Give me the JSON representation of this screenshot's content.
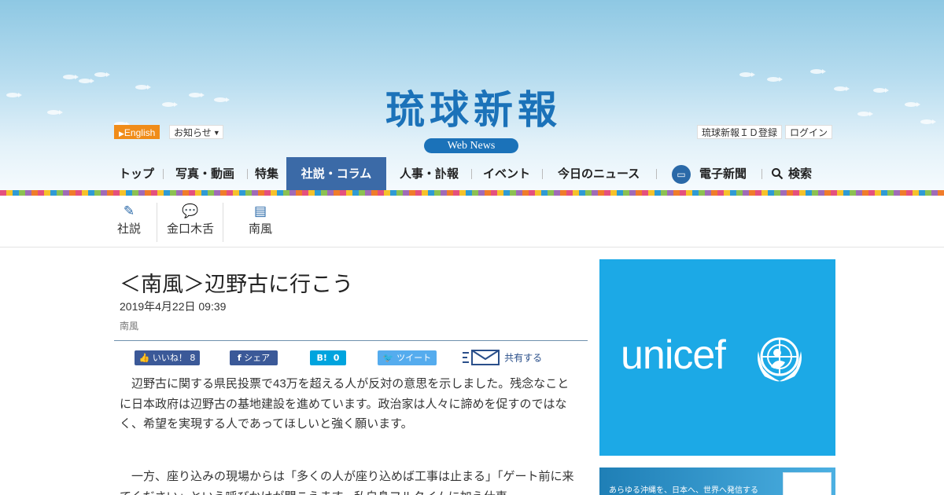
{
  "header": {
    "logo_text": "琉球新報",
    "logo_badge": "Web News",
    "english": "English",
    "notice": "お知らせ",
    "register": "琉球新報ＩＤ登録",
    "login": "ログイン"
  },
  "nav": {
    "items": [
      "トップ",
      "写真・動画",
      "特集",
      "社説・コラム",
      "人事・訃報",
      "イベント",
      "今日のニュース",
      "電子新聞",
      "検索"
    ],
    "active_index": 3
  },
  "subnav": {
    "items": [
      "社説",
      "金口木舌",
      "南風"
    ]
  },
  "article": {
    "title": "＜南風＞辺野古に行こう",
    "date": "2019年4月22日 09:39",
    "category": "南風",
    "paragraphs": [
      "辺野古に関する県民投票で43万を超える人が反対の意思を示しました。残念なことに日本政府は辺野古の基地建設を進めています。政治家は人々に諦めを促すのではなく、希望を実現する人であってほしいと強く願います。",
      "一方、座り込みの現場からは「多くの人が座り込めば工事は止まる」「ゲート前に来てください」という呼びかけが聞こえます。私自身フルタイムに加え仕事"
    ]
  },
  "share": {
    "like_label": "いいね！",
    "like_count": "8",
    "share_label": "シェア",
    "hatena_label": "B!",
    "hatena_count": "0",
    "tweet_label": "ツイート",
    "mail_label": "共有する"
  },
  "ads": {
    "unicef_text": "unicef",
    "banner_text": "あらゆる沖縄を、日本へ、世界へ発信する"
  },
  "colors": {
    "brand_blue": "#1b72b9",
    "nav_active": "#3b6aa7",
    "unicef_bg": "#1ca9e6",
    "facebook": "#3b5998",
    "twitter": "#55acee",
    "hatena": "#00a4de",
    "english_orange": "#f08c19"
  }
}
